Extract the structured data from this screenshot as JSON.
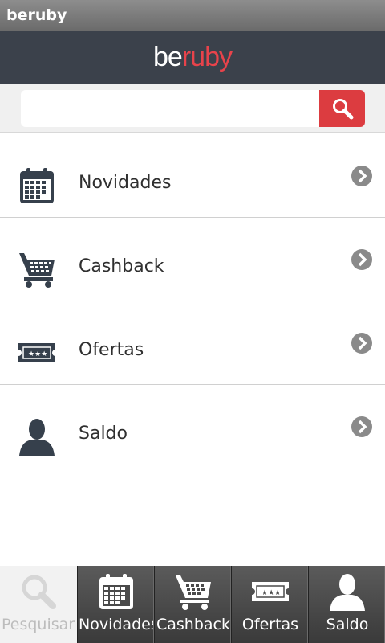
{
  "app": {
    "title": "beruby"
  },
  "header": {
    "logo_part1": "be",
    "logo_part2": "ruby",
    "brand_color": "#e8434b",
    "bar_color": "#3b414b"
  },
  "search": {
    "value": "",
    "placeholder": "",
    "button_color": "#dc3c40"
  },
  "menu": {
    "items": [
      {
        "label": "Novidades",
        "icon": "calendar-icon"
      },
      {
        "label": "Cashback",
        "icon": "cart-icon"
      },
      {
        "label": "Ofertas",
        "icon": "ticket-icon"
      },
      {
        "label": "Saldo",
        "icon": "person-icon"
      }
    ]
  },
  "tabs": [
    {
      "label": "Pesquisar",
      "icon": "search-icon",
      "active": true
    },
    {
      "label": "Novidades",
      "icon": "calendar-icon",
      "active": false
    },
    {
      "label": "Cashback",
      "icon": "cart-icon",
      "active": false
    },
    {
      "label": "Ofertas",
      "icon": "ticket-icon",
      "active": false
    },
    {
      "label": "Saldo",
      "icon": "person-icon",
      "active": false
    }
  ]
}
